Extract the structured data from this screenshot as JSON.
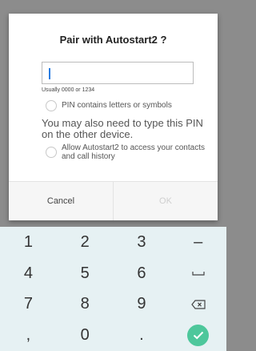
{
  "dialog": {
    "title": "Pair with Autostart2 ?",
    "pin_value": "",
    "hint": "Usually 0000 or 1234",
    "pin_letters_label": "PIN contains letters or symbols",
    "info": "You may also need to type this PIN on the other device.",
    "access_label": "Allow Autostart2  to access your contacts and call history",
    "cancel_label": "Cancel",
    "ok_label": "OK"
  },
  "keyboard": {
    "keys": [
      "1",
      "2",
      "3",
      "–",
      "4",
      "5",
      "6",
      "space",
      "7",
      "8",
      "9",
      "backspace",
      ",",
      "0",
      ".",
      "done"
    ],
    "labels": {
      "k1": "1",
      "k2": "2",
      "k3": "3",
      "dash": "–",
      "k4": "4",
      "k5": "5",
      "k6": "6",
      "k7": "7",
      "k8": "8",
      "k9": "9",
      "comma": ",",
      "k0": "0",
      "dot": "."
    },
    "icons": {
      "space": "space-icon",
      "backspace": "backspace-icon",
      "done": "check-icon"
    },
    "done_color": "#4dc79b"
  },
  "colors": {
    "accent": "#2a7de1",
    "keyboard_bg": "#e6f1f3",
    "scrim": "#8c8c8c"
  }
}
